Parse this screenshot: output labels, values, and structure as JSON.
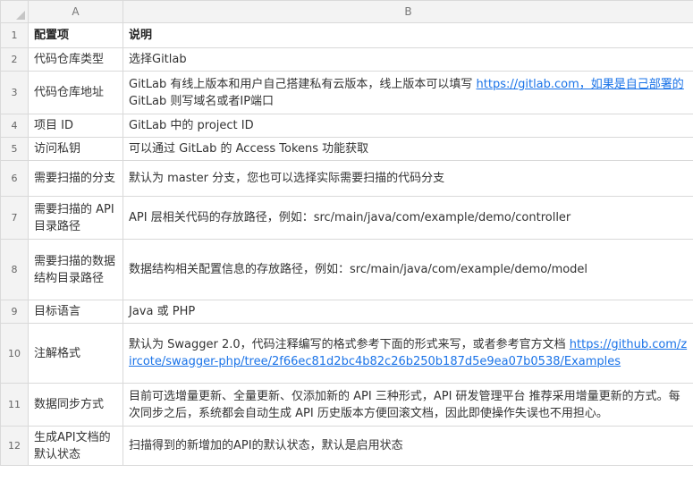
{
  "columns": [
    "A",
    "B"
  ],
  "rows": [
    {
      "num": "1",
      "a": "配置项",
      "b_parts": [
        {
          "text": "说明"
        }
      ],
      "header": true
    },
    {
      "num": "2",
      "a": "代码仓库类型",
      "b_parts": [
        {
          "text": "选择Gitlab"
        }
      ]
    },
    {
      "num": "3",
      "a": "代码仓库地址",
      "b_parts": [
        {
          "text": "GitLab 有线上版本和用户自己搭建私有云版本，线上版本可以填写 "
        },
        {
          "text": "https://gitlab.com，如果是自己部署的",
          "link": true
        },
        {
          "text": " GitLab 则写域名或者IP端口"
        }
      ]
    },
    {
      "num": "4",
      "a": "项目 ID",
      "b_parts": [
        {
          "text": "GitLab 中的 project ID"
        }
      ]
    },
    {
      "num": "5",
      "a": "访问私钥",
      "b_parts": [
        {
          "text": "可以通过 GitLab 的 Access Tokens 功能获取"
        }
      ]
    },
    {
      "num": "6",
      "a": "需要扫描的分支",
      "b_parts": [
        {
          "text": "默认为 master 分支，您也可以选择实际需要扫描的代码分支"
        }
      ]
    },
    {
      "num": "7",
      "a": "需要扫描的 API 目录路径",
      "b_parts": [
        {
          "text": "API 层相关代码的存放路径，例如：src/main/java/com/example/demo/controller"
        }
      ]
    },
    {
      "num": "8",
      "a": "需要扫描的数据结构目录路径",
      "b_parts": [
        {
          "text": "数据结构相关配置信息的存放路径，例如：src/main/java/com/example/demo/model"
        }
      ]
    },
    {
      "num": "9",
      "a": "目标语言",
      "b_parts": [
        {
          "text": "Java 或 PHP"
        }
      ]
    },
    {
      "num": "10",
      "a": "注解格式",
      "b_parts": [
        {
          "text": "默认为 Swagger 2.0，代码注释编写的格式参考下面的形式来写，或者参考官方文档 "
        },
        {
          "text": "https://github.com/zircote/swagger-php/tree/2f66ec81d2bc4b82c26b250b187d5e9ea07b0538/Examples",
          "link": true
        }
      ]
    },
    {
      "num": "11",
      "a": "数据同步方式",
      "b_parts": [
        {
          "text": "目前可选增量更新、全量更新、仅添加新的 API 三种形式，API 研发管理平台 推荐采用增量更新的方式。每次同步之后，系统都会自动生成 API 历史版本方便回滚文档，因此即使操作失误也不用担心。"
        }
      ]
    },
    {
      "num": "12",
      "a": "生成API文档的默认状态",
      "b_parts": [
        {
          "text": "扫描得到的新增加的API的默认状态，默认是启用状态"
        }
      ]
    }
  ]
}
